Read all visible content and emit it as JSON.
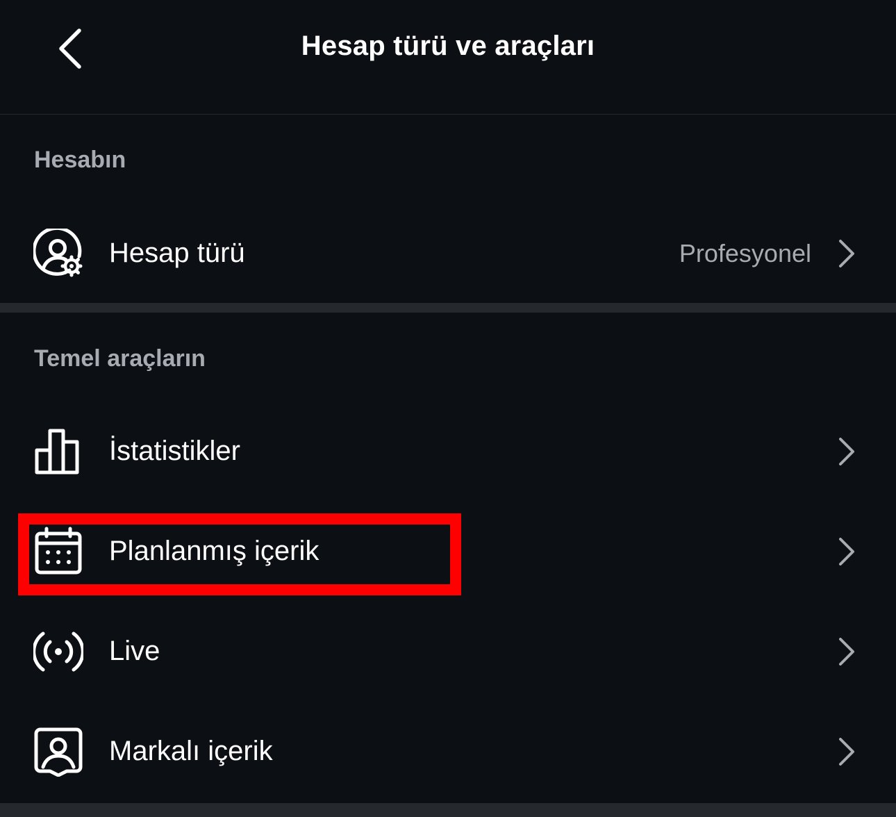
{
  "header": {
    "title": "Hesap türü ve araçları",
    "back_icon": "chevron-left-icon"
  },
  "sections": {
    "account": {
      "title": "Hesabın"
    },
    "tools": {
      "title": "Temel araçların"
    }
  },
  "rows": {
    "account_type": {
      "label": "Hesap türü",
      "value": "Profesyonel",
      "icon": "user-settings-icon"
    },
    "insights": {
      "label": "İstatistikler",
      "icon": "bar-chart-icon"
    },
    "scheduled": {
      "label": "Planlanmış içerik",
      "icon": "calendar-icon"
    },
    "live": {
      "label": "Live",
      "icon": "broadcast-icon"
    },
    "branded": {
      "label": "Markalı içerik",
      "icon": "branded-content-icon"
    }
  },
  "colors": {
    "background": "#0c0f14",
    "secondary_text": "#a8acb2",
    "highlight": "#ff0000"
  }
}
